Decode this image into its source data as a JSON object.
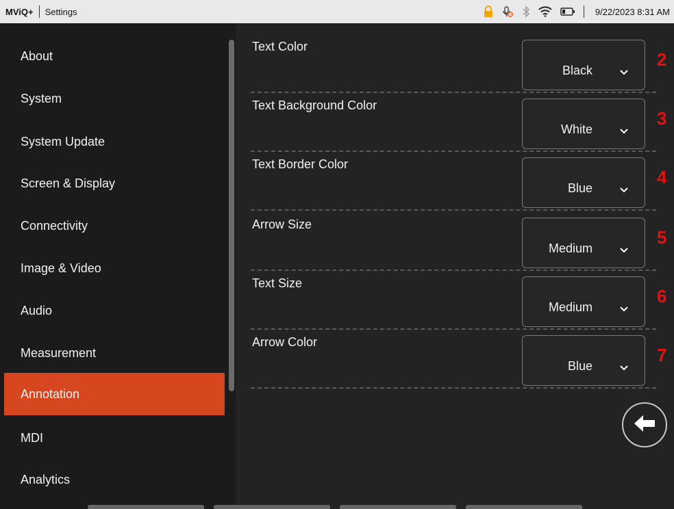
{
  "topbar": {
    "brand": "MViQ+",
    "breadcrumb": "Settings",
    "datetime": "9/22/2023  8:31 AM",
    "icons": [
      "lock-icon",
      "mic-muted-icon",
      "bluetooth-icon",
      "wifi-icon",
      "battery-icon"
    ],
    "lock_color": "#f0a500",
    "mute_badge_color": "#f26522"
  },
  "sidebar": {
    "accent": "#d6461f",
    "items": [
      {
        "label": "About"
      },
      {
        "label": "System"
      },
      {
        "label": "System Update"
      },
      {
        "label": "Screen & Display"
      },
      {
        "label": "Connectivity"
      },
      {
        "label": "Image & Video"
      },
      {
        "label": "Audio"
      },
      {
        "label": "Measurement"
      },
      {
        "label": "Annotation",
        "active": true
      },
      {
        "label": "MDI"
      },
      {
        "label": "Analytics"
      }
    ]
  },
  "settings": {
    "rows": [
      {
        "label": "Text Color",
        "value": "Black",
        "callout": "2"
      },
      {
        "label": "Text Background Color",
        "value": "White",
        "callout": "3"
      },
      {
        "label": "Text Border Color",
        "value": "Blue",
        "callout": "4"
      },
      {
        "label": "Arrow Size",
        "value": "Medium",
        "callout": "5"
      },
      {
        "label": "Text Size",
        "value": "Medium",
        "callout": "6"
      },
      {
        "label": "Arrow Color",
        "value": "Blue",
        "callout": "7"
      }
    ],
    "callout_color": "#e01212"
  },
  "back_button": {
    "icon": "arrow-left-icon"
  }
}
